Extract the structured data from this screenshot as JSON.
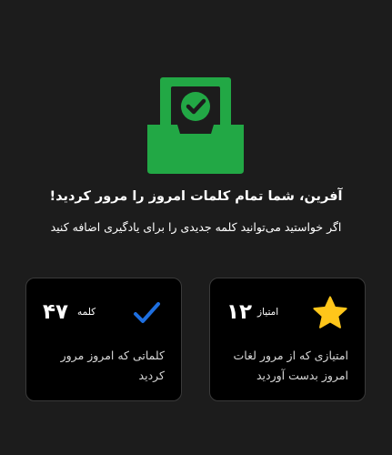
{
  "header": {
    "title": "آفرین، شما تمام کلمات امروز را مرور کردید!",
    "subtitle": "اگر خواستید می‌توانید کلمه جدیدی را برای یادگیری اضافه کنید"
  },
  "stats": {
    "points": {
      "value": "۱۲",
      "unit": "امتیاز",
      "description": "امتیازی که از مرور لغات امروز بدست آوردید",
      "icon": "star-icon"
    },
    "words": {
      "value": "۴۷",
      "unit": "کلمه",
      "description": "کلماتی که امروز مرور کردید",
      "icon": "checkmark-icon"
    }
  },
  "colors": {
    "background": "#1c1c1c",
    "card": "#000000",
    "success": "#22a845",
    "star": "#ffc61a",
    "check": "#1e6fe0"
  }
}
